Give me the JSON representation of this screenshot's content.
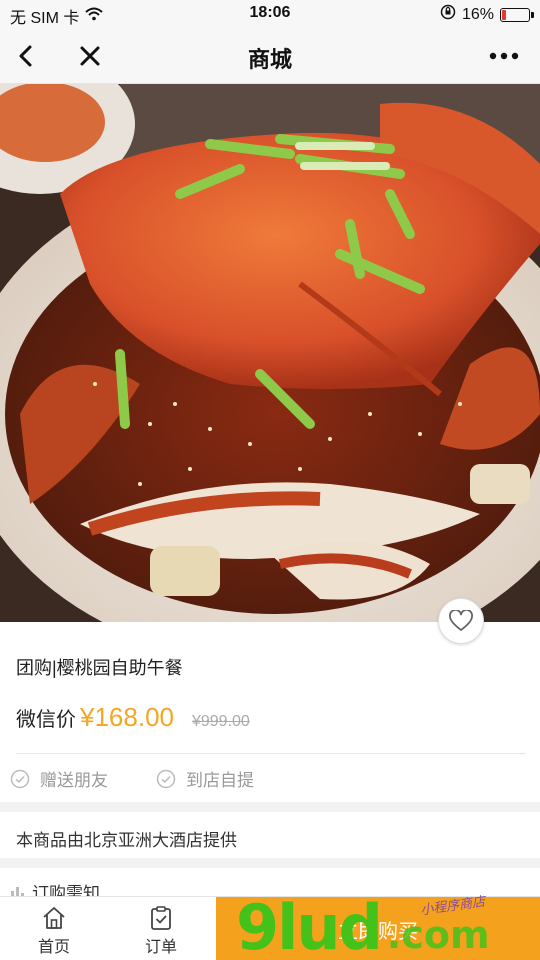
{
  "status_bar": {
    "carrier": "无 SIM 卡",
    "time": "18:06",
    "battery_percent": "16%",
    "battery_level": 0.16,
    "battery_color": "#e53935"
  },
  "nav": {
    "title": "商城",
    "back_icon": "chevron-left-icon",
    "close_icon": "close-icon",
    "more_icon": "more-horizontal-icon"
  },
  "product": {
    "title": "团购|樱桃园自助午餐",
    "price_label": "微信价",
    "price": "¥168.00",
    "original_price": "¥999.00",
    "tags": [
      "赠送朋友",
      "到店自提"
    ],
    "supplier": "本商品由北京亚洲大酒店提供",
    "notice": "订购需知"
  },
  "tab_bar": {
    "home": "首页",
    "orders": "订单",
    "buy": "立即购买"
  },
  "watermark": {
    "text": "9lud",
    "suffix": ".com",
    "tagline": "小程序商店"
  },
  "colors": {
    "accent": "#f4a21d",
    "price": "#f5a623",
    "watermark_green": "#44c21a"
  }
}
